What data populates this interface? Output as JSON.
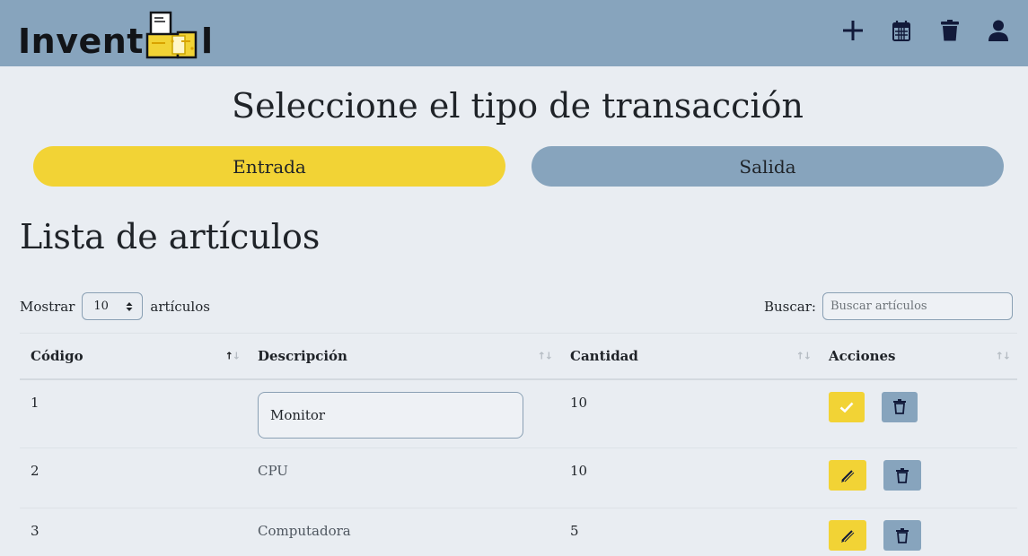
{
  "app": {
    "brand_prefix": "Invent",
    "brand_suffix": "l"
  },
  "colors": {
    "topbar": "#87a4bd",
    "accent_yellow": "#f2d335",
    "accent_blue": "#87a4bd",
    "background": "#e9edf2"
  },
  "nav": {
    "icons": [
      "plus-icon",
      "calendar-icon",
      "trash-icon",
      "user-icon"
    ]
  },
  "transaction": {
    "title": "Seleccione el tipo de transacción",
    "entrada_label": "Entrada",
    "salida_label": "Salida"
  },
  "list": {
    "title": "Lista de artículos",
    "show_prefix": "Mostrar",
    "page_size": "10",
    "show_suffix": "artículos",
    "search_label": "Buscar:",
    "search_placeholder": "Buscar artículos",
    "columns": [
      "Código",
      "Descripción",
      "Cantidad",
      "Acciones"
    ],
    "rows": [
      {
        "code": "1",
        "description": "Monitor",
        "quantity": "10",
        "editing": true
      },
      {
        "code": "2",
        "description": "CPU",
        "quantity": "10",
        "editing": false
      },
      {
        "code": "3",
        "description": "Computadora",
        "quantity": "5",
        "editing": false
      }
    ]
  }
}
